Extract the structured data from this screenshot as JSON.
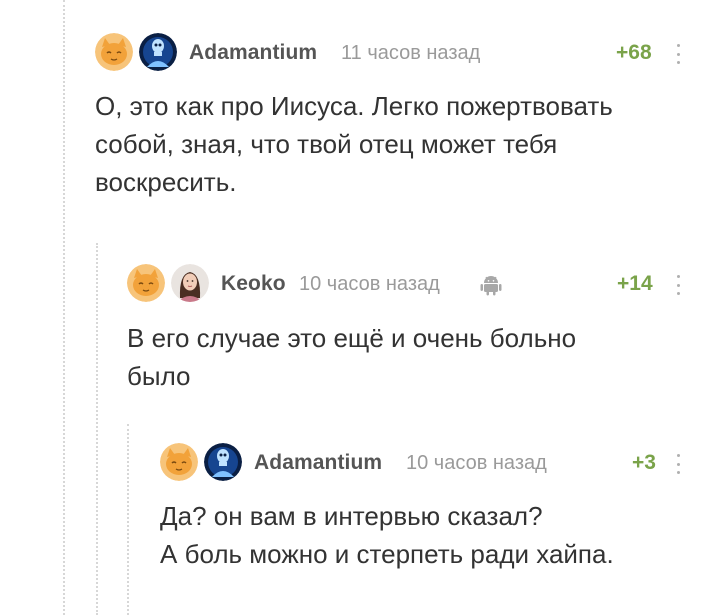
{
  "comments": [
    {
      "author": "Adamantium",
      "time": "11 часов назад",
      "rating": "+68",
      "text": "О, это как про Иисуса. Легко пожертвовать\nсобой, зная, что твой отец может тебя\nвоскресить.",
      "badge_icon": "cat-badge-icon",
      "avatar_icon": "glowing-skeleton-avatar"
    },
    {
      "author": "Keoko",
      "time": "10 часов назад",
      "rating": "+14",
      "text": "В его случае это ещё и очень больно\nбыло",
      "badge_icon": "cat-badge-icon",
      "avatar_icon": "woman-photo-avatar",
      "platform_icon": "android-icon"
    },
    {
      "author": "Adamantium",
      "time": "10 часов назад",
      "rating": "+3",
      "text": "Да? он вам в интервью сказал?\nА боль можно и стерпеть ради хайпа.",
      "badge_icon": "cat-badge-icon",
      "avatar_icon": "glowing-skeleton-avatar"
    }
  ],
  "colors": {
    "rating_positive": "#7aa34a",
    "author": "#555555",
    "time": "#9a9a9a",
    "text": "#333333",
    "thread_line": "#d7d7d7",
    "cat_badge": "#f2a23a",
    "skeleton_glow": "#2a7ad8"
  }
}
